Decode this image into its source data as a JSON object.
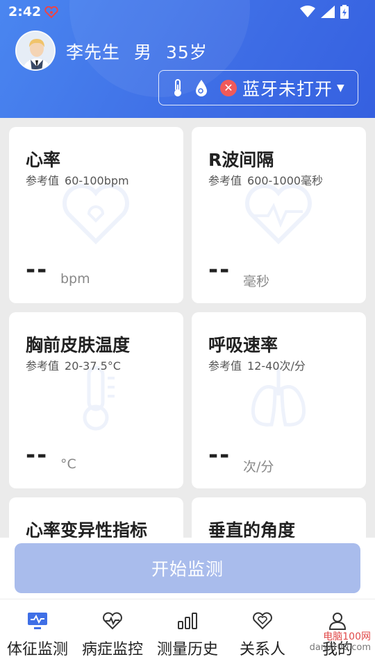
{
  "status_bar": {
    "time": "2:42"
  },
  "user": {
    "name": "李先生",
    "gender": "男",
    "age": "35岁"
  },
  "bluetooth": {
    "status_text": "蓝牙未打开"
  },
  "cards": [
    {
      "title": "心率",
      "ref_label": "参考值",
      "ref_value": "60-100bpm",
      "value": "--",
      "unit": "bpm",
      "icon": "heart-icon"
    },
    {
      "title": "R波间隔",
      "ref_label": "参考值",
      "ref_value": "600-1000毫秒",
      "value": "--",
      "unit": "毫秒",
      "icon": "heartbeat-icon"
    },
    {
      "title": "胸前皮肤温度",
      "ref_label": "参考值",
      "ref_value": "20-37.5°C",
      "value": "--",
      "unit": "°C",
      "icon": "thermometer-icon"
    },
    {
      "title": "呼吸速率",
      "ref_label": "参考值",
      "ref_value": "12-40次/分",
      "value": "--",
      "unit": "次/分",
      "icon": "lungs-icon"
    },
    {
      "title": "心率变异性指标",
      "icon": "none"
    },
    {
      "title": "垂直的角度",
      "icon": "none"
    }
  ],
  "start_button": {
    "label": "开始监测"
  },
  "tabs": [
    {
      "label": "体征监测",
      "icon": "vitals-monitor-icon",
      "active": true
    },
    {
      "label": "病症监控",
      "icon": "heart-pulse-icon"
    },
    {
      "label": "测量历史",
      "icon": "bar-chart-icon"
    },
    {
      "label": "关系人",
      "icon": "hearts-icon"
    },
    {
      "label": "我的",
      "icon": "person-icon"
    }
  ],
  "watermark": {
    "brand": "电脑100网",
    "site": "danji100.com"
  },
  "colors": {
    "header_blue": "#3f6fe6",
    "start_button": "#a9bcec",
    "bt_error": "#f05a5a"
  }
}
